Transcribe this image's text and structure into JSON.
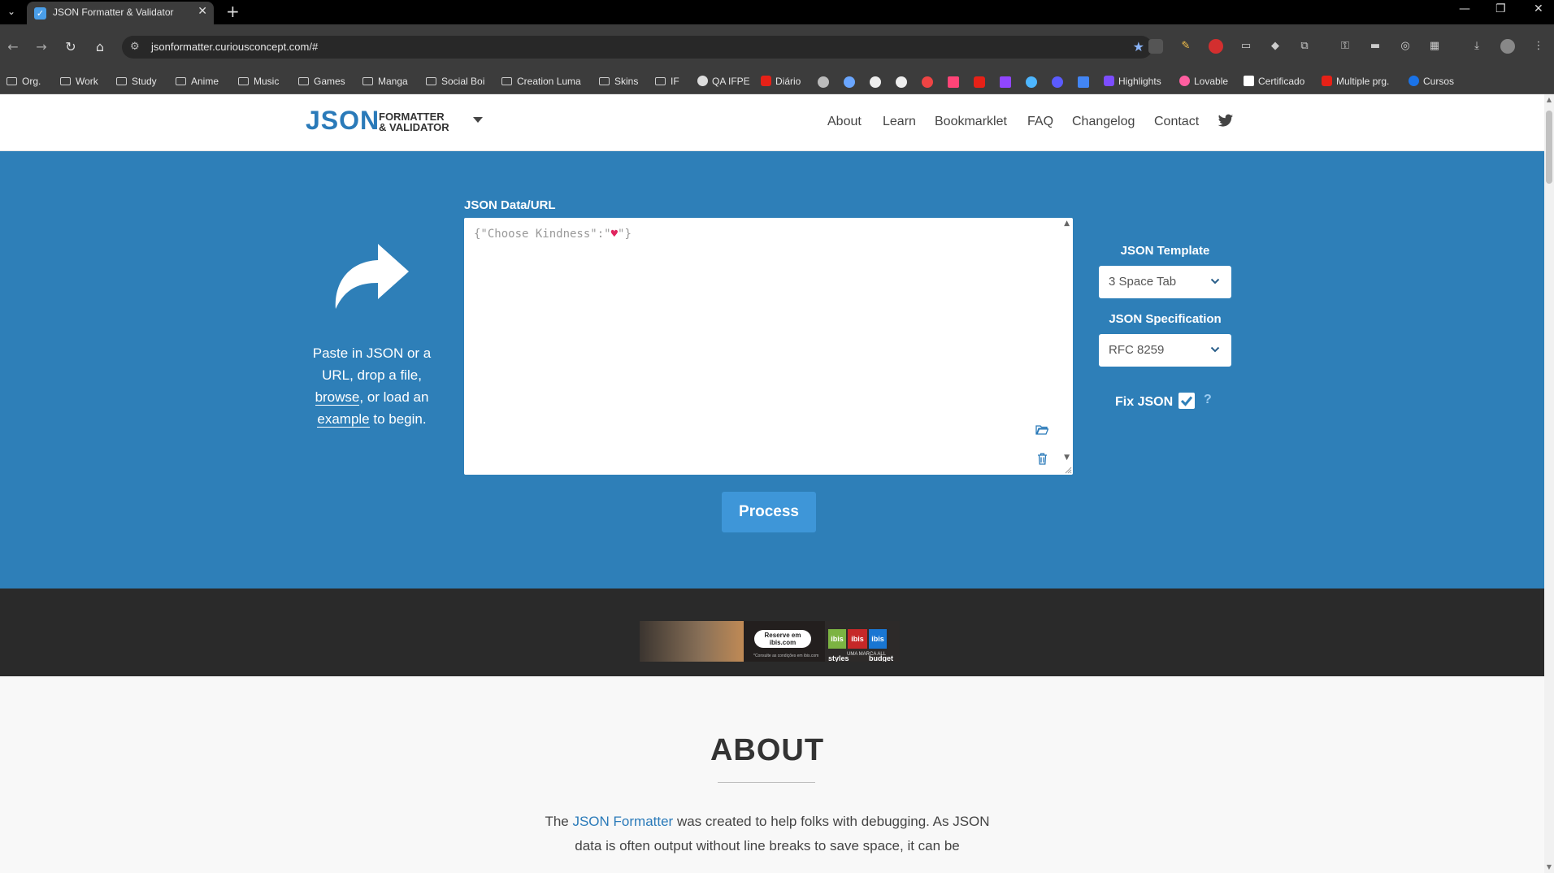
{
  "browser": {
    "tab_title": "JSON Formatter & Validator",
    "url": "jsonformatter.curiousconcept.com/#",
    "bookmarks": [
      "Org.",
      "Work",
      "Study",
      "Anime",
      "Music",
      "Games",
      "Manga",
      "Social Boi",
      "Creation Luma",
      "Skins",
      "IF",
      "QA IFPE",
      "Diário",
      "Highlights",
      "Lovable",
      "Certificado",
      "Multiple prg.",
      "Cursos"
    ]
  },
  "header": {
    "logo_main": "JSON",
    "logo_line1": "FORMATTER",
    "logo_line2": "& VALIDATOR",
    "nav": [
      "About",
      "Learn",
      "Bookmarklet",
      "FAQ",
      "Changelog",
      "Contact"
    ]
  },
  "hero": {
    "hint_pre": "Paste in JSON or a URL, drop a file,",
    "hint_browse": "browse",
    "hint_mid": ", or load an",
    "hint_example": "example",
    "hint_post": "to begin.",
    "data_label": "JSON Data/URL",
    "json_text_pre": "{\"Choose Kindness\":\"",
    "json_heart": "♥",
    "json_text_post": "\"}",
    "template_label": "JSON Template",
    "template_value": "3 Space Tab",
    "spec_label": "JSON Specification",
    "spec_value": "RFC 8259",
    "fix_label": "Fix JSON",
    "fix_checked": true,
    "help": "?",
    "process_label": "Process"
  },
  "ad": {
    "pill_line1": "Reserve em",
    "pill_line2": "ibis.com",
    "fine_print": "*Consulte as condições em ibis.com",
    "logos": [
      "ibis styles",
      "ibis",
      "ibis budget"
    ],
    "brand": "UMA MARCA ALL"
  },
  "about": {
    "title": "ABOUT",
    "text_pre": "The",
    "text_link": "JSON Formatter",
    "text_post": "was created to help folks with debugging. As JSON data is often output without line breaks to save space, it can be"
  },
  "colors": {
    "brand": "#2a7ab9",
    "hero_bg": "#2e7fb8",
    "process_bg": "#3e96d8",
    "ad_band": "#2a2a2a"
  }
}
